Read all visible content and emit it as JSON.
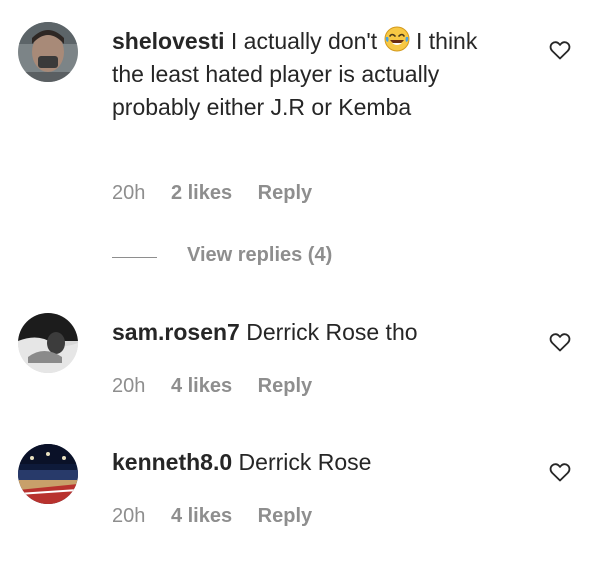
{
  "comments": [
    {
      "username": "shelovesti",
      "text_before": "I actually don't",
      "emoji": "face-with-tears-of-joy",
      "text_after": "I think the least hated player is actually probably either J.R or Kemba",
      "time": "20h",
      "likes": "2 likes",
      "reply": "Reply",
      "view_replies": "View replies (4)"
    },
    {
      "username": "sam.rosen7",
      "text": "Derrick Rose tho",
      "time": "20h",
      "likes": "4 likes",
      "reply": "Reply"
    },
    {
      "username": "kenneth8.0",
      "text": "Derrick Rose",
      "time": "20h",
      "likes": "4 likes",
      "reply": "Reply"
    }
  ],
  "icons": {
    "like": "heart-outline-icon"
  },
  "colors": {
    "text": "#262626",
    "secondary": "#8e8e8e",
    "background": "#ffffff"
  }
}
